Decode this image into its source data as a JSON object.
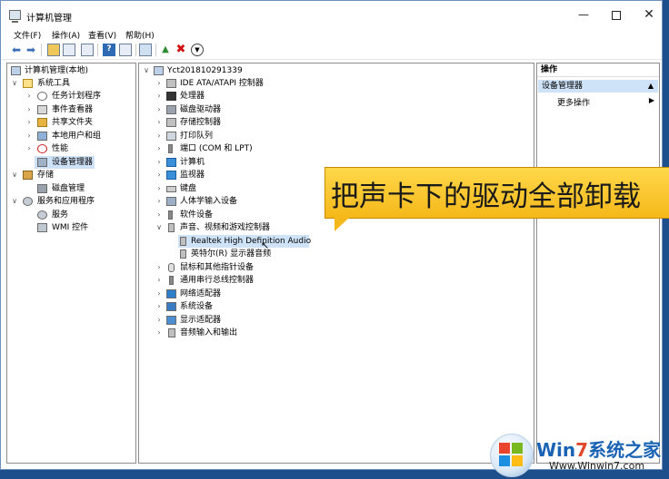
{
  "window": {
    "title": "计算机管理"
  },
  "menu": [
    "文件(F)",
    "操作(A)",
    "查看(V)",
    "帮助(H)"
  ],
  "left_tree": {
    "root": "计算机管理(本地)",
    "system_tools": "系统工具",
    "system_tools_children": [
      "任务计划程序",
      "事件查看器",
      "共享文件夹",
      "本地用户和组",
      "性能",
      "设备管理器"
    ],
    "storage": "存储",
    "storage_children": [
      "磁盘管理"
    ],
    "services_apps": "服务和应用程序",
    "services_apps_children": [
      "服务",
      "WMI 控件"
    ]
  },
  "device_tree": {
    "computer": "Yct201810291339",
    "categories": [
      "IDE ATA/ATAPI 控制器",
      "处理器",
      "磁盘驱动器",
      "存储控制器",
      "打印队列",
      "端口 (COM 和 LPT)",
      "计算机",
      "监视器",
      "键盘",
      "人体学输入设备",
      "软件设备",
      "声音、视频和游戏控制器"
    ],
    "sound_children": [
      "Realtek High Definition Audio",
      "英特尔(R) 显示器音频"
    ],
    "categories_after": [
      "鼠标和其他指针设备",
      "通用串行总线控制器",
      "网络适配器",
      "系统设备",
      "显示适配器",
      "音频输入和输出"
    ]
  },
  "actions": {
    "header": "操作",
    "group": "设备管理器",
    "more": "更多操作"
  },
  "overlay": {
    "caption": "把声卡下的驱动全部卸载"
  },
  "watermark": {
    "title_a": "Win",
    "title_i": "7",
    "title_b": "系统之家",
    "url": "Www.Winwin7.com"
  }
}
